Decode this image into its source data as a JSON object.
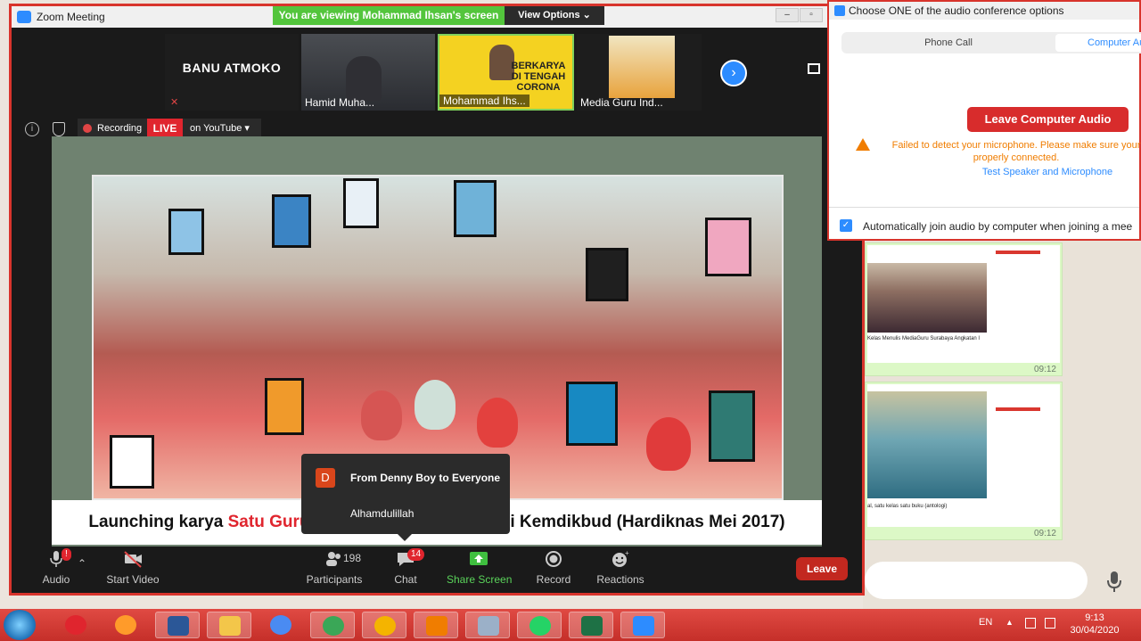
{
  "window": {
    "title": "Zoom Meeting",
    "viewing_banner": "You are viewing Mohammad Ihsan's screen",
    "view_options": "View Options ⌄"
  },
  "gallery": {
    "tiles": [
      {
        "name": "BANU ATMOKO"
      },
      {
        "name": "Hamid Muha..."
      },
      {
        "name": "Mohammad Ihs..."
      },
      {
        "name": "Media Guru Ind..."
      }
    ],
    "ihsan_headline": "BERKARYA DI TENGAH CORONA"
  },
  "recording": {
    "label": "Recording",
    "live": "LIVE",
    "destination": "on YouTube ▾"
  },
  "shared": {
    "caption_before": "Launching karya ",
    "caption_red": "Satu Guru Satu",
    "caption_after": " Buku (Sagusabu) di Kemdikbud (Hardiknas Mei 2017)"
  },
  "chat_popup": {
    "avatar": "D",
    "from": "From Denny Boy to Everyone",
    "message": "Alhamdulillah"
  },
  "toolbar": {
    "audio": "Audio",
    "video": "Start Video",
    "participants": "Participants",
    "participants_count": "198",
    "chat": "Chat",
    "chat_count": "14",
    "share": "Share Screen",
    "record": "Record",
    "reactions": "Reactions",
    "leave": "Leave"
  },
  "audio_dialog": {
    "title": "Choose ONE of the audio conference options",
    "tab_phone": "Phone Call",
    "tab_computer": "Computer Au",
    "leave_audio": "Leave Computer Audio",
    "warning_line1": "Failed to detect your microphone. Please make sure your",
    "warning_line2": "properly connected.",
    "test_link": "Test Speaker and Microphone",
    "auto_join": "Automatically join audio by computer when joining a mee"
  },
  "whatsapp": {
    "time1": "09:12",
    "time2": "09:12",
    "caption1": "Kelas Menulis MediaGuru Surabaya Angkatan I",
    "caption2": "al, satu kelas satu buku (antologi)"
  },
  "taskbar": {
    "lang": "EN",
    "time": "9:13",
    "date": "30/04/2020"
  },
  "colors": {
    "zoom_blue": "#2d8cff",
    "leave_red": "#c2281f",
    "live_red": "#e0252e",
    "share_green": "#5ad35a",
    "taskbar": "#c52f29"
  }
}
